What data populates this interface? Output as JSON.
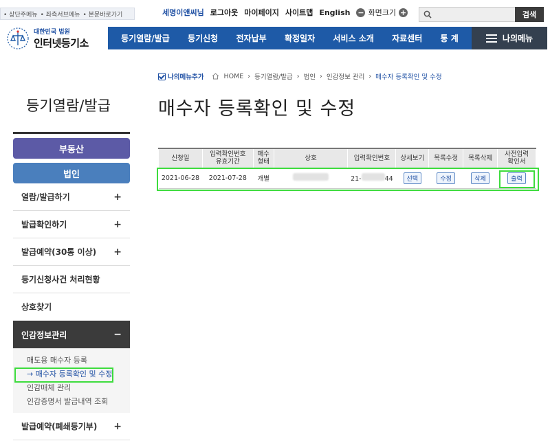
{
  "skip_links": [
    "• 상단주메뉴",
    "• 좌측서브메뉴",
    "• 본문바로가기"
  ],
  "util": {
    "welcome": "세명이앤씨님",
    "logout": "로그아웃",
    "mypage": "마이페이지",
    "sitemap": "사이트맵",
    "english": "English",
    "screen_size": "화면크기"
  },
  "search": {
    "button": "검색",
    "placeholder": ""
  },
  "logo": {
    "line1": "대한민국 법원",
    "line2": "인터넷등기소"
  },
  "gnb": [
    "등기열람/발급",
    "등기신청",
    "전자납부",
    "확정일자",
    "서비스 소개",
    "자료센터",
    "통 계"
  ],
  "my_menu": "나의메뉴",
  "breadcrumb": {
    "add": "나의메뉴추가",
    "items": [
      "HOME",
      "등기열람/발급",
      "법인",
      "인감정보 관리"
    ],
    "current": "매수자 등록확인 및 수정"
  },
  "section_title": "등기열람/발급",
  "page_title": "매수자 등록확인 및 수정",
  "sidebar": {
    "cat_a": "부동산",
    "cat_b": "법인",
    "items": [
      "열람/발급하기",
      "발급확인하기",
      "발급예약(30통 이상)",
      "등기신청사건 처리현황",
      "상호찾기",
      "인감정보관리"
    ],
    "sub": [
      "매도용 매수자 등록",
      "매수자 등록확인 및 수정",
      "인감매체 관리",
      "인감증명서 발급내역 조회"
    ],
    "last": "발급예약(폐쇄등기부)"
  },
  "table": {
    "headers": [
      "신청일",
      "입력확인번호\n유효기간",
      "매수\n형태",
      "상호",
      "입력확인번호",
      "상세보기",
      "목록수정",
      "목록삭제",
      "사전입력\n확인서"
    ],
    "row": {
      "date": "2021-06-28",
      "expiry": "2021-07-28",
      "type": "개별",
      "no_prefix": "21-",
      "no_suffix": "44",
      "view": "선택",
      "edit": "수정",
      "del": "삭제",
      "print": "출력"
    }
  },
  "colors": {
    "primary": "#1e5aa7",
    "highlight": "#3ddc3d",
    "cat_a": "#5c5aa6",
    "cat_b": "#4a7fbd"
  }
}
